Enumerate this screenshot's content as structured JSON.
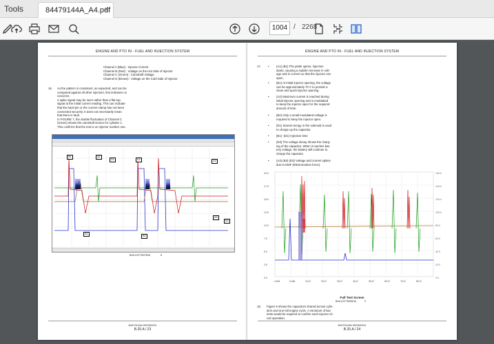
{
  "app": {
    "tools_label": "Tools",
    "tab_title": "84479144A_A4.pdf",
    "tab_close": "×"
  },
  "toolbar": {
    "current_page": "1004",
    "separator": "/",
    "total_pages": "2268"
  },
  "page1": {
    "header": "ENGINE AND PTO IN - FUEL AND INJECTION SYSTEM",
    "channels": [
      {
        "name": "Channel A (Blue)",
        "desc": ": Injector Current"
      },
      {
        "name": "Channel B (Red)",
        "desc": ": Voltage on the Hot Side of Injector"
      },
      {
        "name": "Channel C (Green)",
        "desc": ": Camshaft Voltage"
      },
      {
        "name": "Channel D (Brown)",
        "desc": ": Voltage on the Cold Side of Injector"
      }
    ],
    "step_num": "16.",
    "para_lines": [
      "As the pattern is consistent, as expected, and can be",
      "compared against all other injectors, this indicates no",
      "concerns.",
      "A spike signal may be seen rather than a flat top",
      "signal at the initial current reading. This can indicate",
      "that the back-pin or the current clamp has not been",
      "connected securely. It does not necessarily mean",
      "that there is fault.",
      "In FIGURE 7, the double fluctuation of Channel C",
      "(Green) shows the camshaft sensor for cylinder 1.",
      "This confirms that the test is on injector number one."
    ],
    "labels": {
      "b1": "B1",
      "a2": "A2",
      "d1": "D1",
      "d2": "D2",
      "d3": "D3",
      "a3": "A3",
      "b3": "B3",
      "b2": "B2",
      "a1": "A1"
    },
    "screenshot_caption": "BAIL10CTM0760A",
    "figure_num": "8",
    "footer_doc": "84479144A 09/06/2011",
    "footer_page": "B.20.A / 23"
  },
  "page2": {
    "header": "ENGINE AND PTO IN - FUEL AND INJECTION SYSTEM",
    "step17": "17.",
    "bullets": [
      {
        "lines": [
          "(A1) (B1) The pintle opens, injection",
          "starts, causing a sudden increase in volt-",
          "age and in current so that the injector can",
          "open."
        ]
      },
      {
        "lines": [
          "(B1) At initial injector opening, the voltage",
          "can be approximately 70 V to provide a",
          "clean and quick injector opening."
        ]
      },
      {
        "lines": [
          "(A2) Maximum current is reached during",
          "initial injector opening and is modulated",
          "to keep the injector open for the required",
          "amount of time."
        ]
      },
      {
        "lines": [
          "(B2) Only a small modulated voltage is",
          "required to keep the injector open."
        ]
      },
      {
        "lines": [
          "(D1) Stored energy in the solenoid is used",
          "to charge up the capacitor."
        ]
      },
      {
        "lines": [
          "(B1)- (D1) Injection time"
        ]
      },
      {
        "lines": [
          "(D3) The voltage decay shows the charg-",
          "ing of the capacitor. When it reaches bat-",
          "tery voltage, the battery will continue to",
          "charge the capacitor."
        ]
      },
      {
        "lines": [
          "(A3) (B3) (D3) Voltage and current spikes",
          "due to EMF (Electromotive force)."
        ]
      }
    ],
    "fig_title": "Full Test Screen",
    "fig_caption": "BAIL10CTM0810A",
    "figure_num": "9",
    "step18": "18.",
    "para18": [
      "Figure 9 shows the capacitors shared across cylin-",
      "ders and one full engine cycle. A minimum of two",
      "tests would be required to confirm each injector cir-",
      "cuit operation."
    ],
    "footer_doc": "84479144A 09/06/2011",
    "footer_page": "B.20.A / 24"
  },
  "colors": {
    "accent": "#2a62c7",
    "channel_a": "#2233cc",
    "channel_b": "#cc1111",
    "channel_c": "#119911",
    "channel_d": "#996633"
  },
  "icons": [
    "create-icon",
    "cloud-upload-icon",
    "print-icon",
    "email-icon",
    "zoom-icon",
    "prev-page-icon",
    "next-page-icon",
    "page-view-icon",
    "tools-layout-icon",
    "two-page-icon"
  ]
}
